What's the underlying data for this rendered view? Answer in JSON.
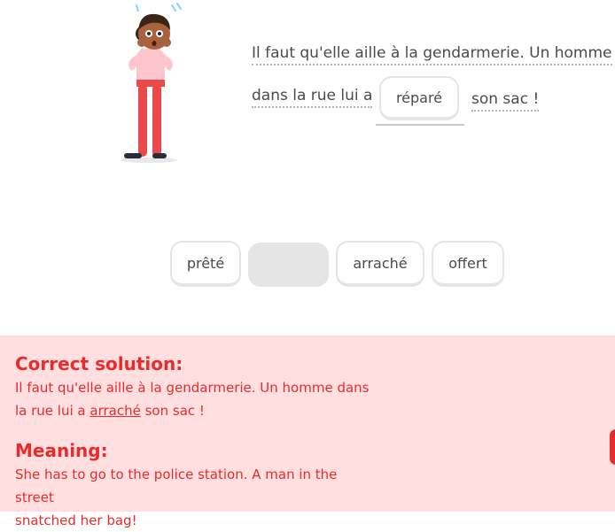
{
  "sentence": {
    "line1": "Il faut qu'elle aille à la gendarmerie. Un homme",
    "line2_before": "dans la rue lui a",
    "filled_word": "réparé",
    "line2_after": "son sac !"
  },
  "word_bank": {
    "words": [
      "prêté",
      "",
      "arraché",
      "offert"
    ]
  },
  "feedback": {
    "solution_title": "Correct solution:",
    "solution_line1": "Il faut qu'elle aille à la gendarmerie. Un homme dans",
    "solution_line2_before": "la rue lui a",
    "solution_answer": "arraché",
    "solution_line2_after": "son sac !",
    "meaning_title": "Meaning:",
    "meaning_line1": "She has to go to the police station. A man in the street",
    "meaning_line2": "snatched her bag!"
  },
  "colors": {
    "error_red": "#ea2b2b",
    "feedback_bg": "#ffdfe0",
    "chip_border": "#e5e5e5"
  }
}
